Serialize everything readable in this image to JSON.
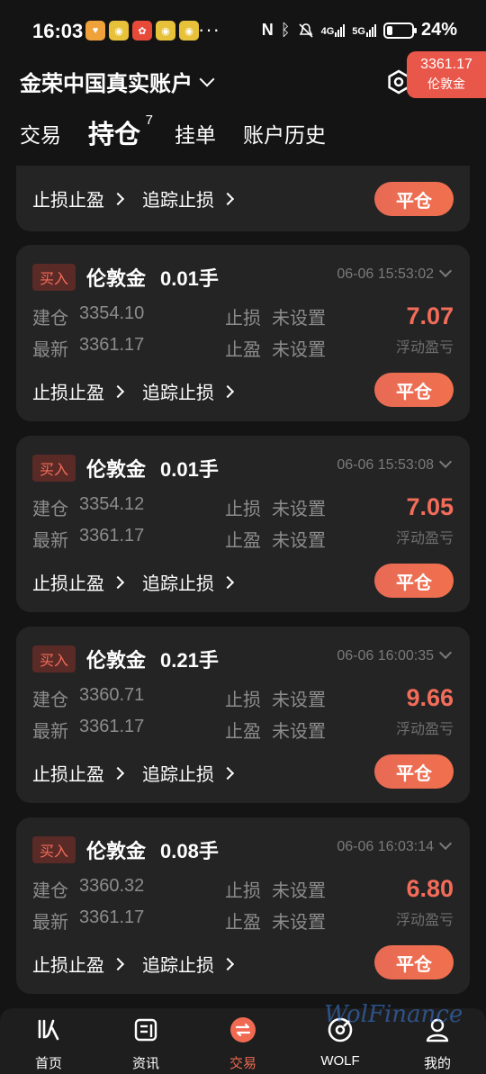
{
  "status": {
    "time": "16:03",
    "more": "···",
    "net1": "4G",
    "net2": "5G",
    "battery_pct": "24%",
    "battery_level": 0.24
  },
  "header": {
    "account": "金荣中国真实账户",
    "price": "3361.17",
    "symbol": "伦敦金"
  },
  "tabs": [
    {
      "label": "交易"
    },
    {
      "label": "持仓",
      "count": "7"
    },
    {
      "label": "挂单"
    },
    {
      "label": "账户历史"
    }
  ],
  "labels": {
    "stop_tp": "止损止盈",
    "trailing": "追踪止损",
    "close": "平仓",
    "open": "建仓",
    "latest": "最新",
    "sl": "止损",
    "tp": "止盈",
    "not_set": "未设置",
    "pnl_label": "浮动盈亏",
    "buy": "买入"
  },
  "positions": [
    {
      "name": "伦敦金",
      "lots": "0.01手",
      "time": "06-06 15:53:02",
      "open": "3354.10",
      "latest": "3361.17",
      "sl": "未设置",
      "tp": "未设置",
      "pnl": "7.07"
    },
    {
      "name": "伦敦金",
      "lots": "0.01手",
      "time": "06-06 15:53:08",
      "open": "3354.12",
      "latest": "3361.17",
      "sl": "未设置",
      "tp": "未设置",
      "pnl": "7.05"
    },
    {
      "name": "伦敦金",
      "lots": "0.21手",
      "time": "06-06 16:00:35",
      "open": "3360.71",
      "latest": "3361.17",
      "sl": "未设置",
      "tp": "未设置",
      "pnl": "9.66"
    },
    {
      "name": "伦敦金",
      "lots": "0.08手",
      "time": "06-06 16:03:14",
      "open": "3360.32",
      "latest": "3361.17",
      "sl": "未设置",
      "tp": "未设置",
      "pnl": "6.80"
    }
  ],
  "nav": [
    {
      "label": "首页"
    },
    {
      "label": "资讯"
    },
    {
      "label": "交易"
    },
    {
      "label": "WOLF"
    },
    {
      "label": "我的"
    }
  ],
  "watermark": "WolFinance",
  "colors": {
    "accent": "#f06a52",
    "background": "#141414",
    "card": "#242424"
  }
}
